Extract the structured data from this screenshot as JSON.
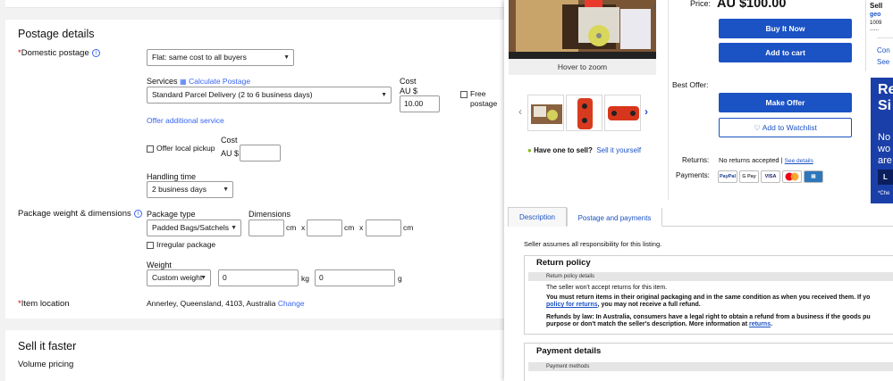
{
  "form": {
    "postage_title": "Postage details",
    "domestic_postage_label": "Domestic postage",
    "domestic_postage_value": "Flat: same cost to all buyers",
    "services_label": "Services",
    "calculate_postage": "Calculate Postage",
    "service_value": "Standard Parcel Delivery (2 to 6 business days)",
    "cost_label": "Cost",
    "currency": "AU $",
    "cost_value": "10.00",
    "free_postage": "Free postage",
    "offer_additional": "Offer additional service",
    "offer_local_pickup": "Offer local pickup",
    "pickup_cost_label": "Cost",
    "pickup_currency": "AU $",
    "pickup_cost_value": "",
    "handling_time_label": "Handling time",
    "handling_time_value": "2 business days",
    "pkg_title": "Package weight & dimensions",
    "pkg_type_label": "Package type",
    "pkg_type_value": "Padded Bags/Satchels",
    "dimensions_label": "Dimensions",
    "dim_unit": "cm",
    "dim_x": "x",
    "irregular_package": "Irregular package",
    "weight_label": "Weight",
    "weight_type_value": "Custom weight",
    "weight_kg_value": "0",
    "weight_kg_unit": "kg",
    "weight_g_value": "0",
    "weight_g_unit": "g",
    "item_location_label": "Item location",
    "item_location_value": "Annerley, Queensland, 4103, Australia",
    "change_link": "Change",
    "sell_faster_title": "Sell it faster",
    "volume_pricing": "Volume pricing"
  },
  "listing": {
    "hover_to_zoom": "Hover to zoom",
    "price_label": "Price:",
    "price_value": "AU $100.00",
    "buy_it_now": "Buy It Now",
    "add_to_cart": "Add to cart",
    "best_offer_label": "Best Offer:",
    "make_offer": "Make Offer",
    "add_to_watchlist": "Add to Watchlist",
    "have_one": "Have one to sell?",
    "sell_it_yourself": "Sell it yourself",
    "returns_label": "Returns:",
    "returns_value": "No returns accepted |",
    "see_details": "See details",
    "payments_label": "Payments:",
    "payment_badges": [
      "PayPal",
      "G Pay",
      "VISA",
      "MC",
      "AMEX"
    ],
    "tabs": [
      "Description",
      "Postage and payments"
    ],
    "seller_responsibility": "Seller assumes all responsibility for this listing.",
    "return_policy_title": "Return policy",
    "return_policy_details": "Return policy details",
    "no_returns_text": "The seller won't accept returns for this item.",
    "must_return_text": "You must return items in their original packaging and in the same condition as when you received them. If yo",
    "policy_link": "policy for returns",
    "policy_tail": ", you may not receive a full refund.",
    "refunds_law": "Refunds by law: In Australia, consumers have a legal right to obtain a refund from a business if the goods pu",
    "refunds_law2": "purpose or don't match the seller's description. More information at",
    "returns_link": "returns",
    "payment_details_title": "Payment details",
    "payment_methods": "Payment methods"
  },
  "side": {
    "sell_label": "Sell",
    "seller_name": "geo",
    "seller_fb": "1009",
    "seller_dots": "......",
    "contact": "Con",
    "see": "See",
    "ad_r": "Re",
    "ad_s": "Si",
    "ad_no": "No",
    "ad_wo": "wo",
    "ad_are": "are",
    "ad_btn": "L",
    "ad_che": "*Che"
  },
  "colors": {
    "accent": "#3665f3",
    "buy_button": "#1b52c4",
    "required": "#d10000",
    "ad_background": "#1a3fa8"
  }
}
